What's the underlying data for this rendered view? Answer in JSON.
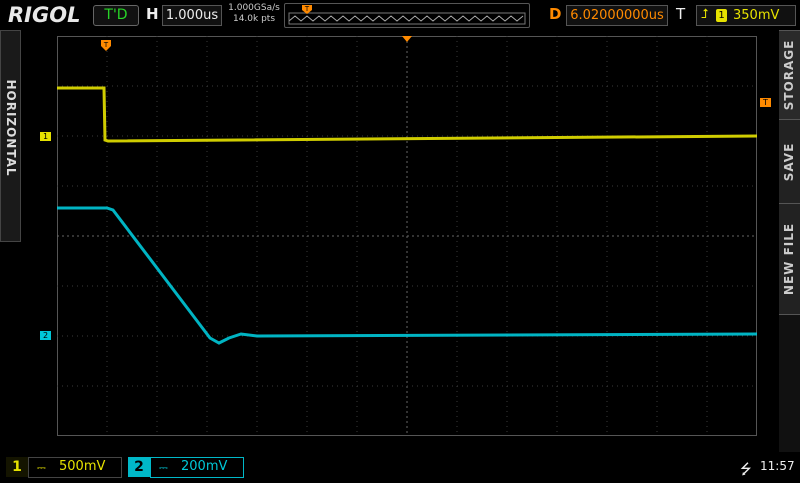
{
  "brand": "RIGOL",
  "run_state": "T'D",
  "horizontal": {
    "label": "H",
    "timebase": "1.000us"
  },
  "acquisition": {
    "sample_rate": "1.000GSa/s",
    "memory_depth": "14.0k pts"
  },
  "delay": {
    "label": "D",
    "value": "6.02000000us"
  },
  "trigger": {
    "label": "T",
    "source": "1",
    "level": "350mV"
  },
  "left_tab": "HORIZONTAL",
  "right_menu": [
    "STORAGE",
    "SAVE",
    "NEW FILE"
  ],
  "markers": {
    "trigger_pos": "T",
    "trigger_level": "T",
    "ch1": "1",
    "ch2": "2"
  },
  "channels": [
    {
      "number": "1",
      "scale": "500mV",
      "color": "#e6e200"
    },
    {
      "number": "2",
      "scale": "200mV",
      "color": "#00c8d8"
    }
  ],
  "status": {
    "time": "11:57"
  },
  "colors": {
    "ch1": "#e6e200",
    "ch2": "#00c8d8",
    "trigger": "#ff8a00",
    "grid": "#3a3a3a"
  }
}
